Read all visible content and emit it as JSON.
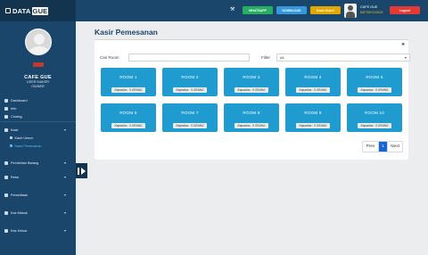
{
  "brand": {
    "name": "DATA",
    "name_badge": "GUE"
  },
  "profile": {
    "name": "CAFE GUE",
    "role_line1": "USER MAKER",
    "role_line2": "OWNER"
  },
  "sidebar": {
    "items": [
      {
        "label": "Dashboard"
      },
      {
        "label": "Info"
      },
      {
        "label": "Closing"
      },
      {
        "label": "Kasir",
        "chevron": "▾"
      },
      {
        "label": "Kasir Umum"
      },
      {
        "label": "Kasir Pemesanan"
      },
      {
        "label": "Pembelian Barang",
        "chevron": "▾"
      },
      {
        "label": "Retur",
        "chevron": "▾"
      },
      {
        "label": "Persediaan",
        "chevron": "▾"
      },
      {
        "label": "Kas Masuk",
        "chevron": "▾"
      },
      {
        "label": "Kas Keluar",
        "chevron": "▾"
      }
    ]
  },
  "topbar": {
    "whatsapp_label": "WHATSAPP",
    "download_label": "DOWNLOAD",
    "kasir_label": "Kasir Dulu!!",
    "logout_label": "Logout",
    "user_name": "CAFE GUE",
    "user_sub": "DAFTAR 01/01/21"
  },
  "page": {
    "title": "Kasir Pemesanan"
  },
  "filters": {
    "search_label": "Cari Room",
    "search_value": "",
    "filter_label": "Filter",
    "filter_value": "All",
    "filter_chevron": "▾"
  },
  "rooms": [
    {
      "name": "ROOM 1",
      "capacity": "Kapasitas : 5 ORANG"
    },
    {
      "name": "ROOM 2",
      "capacity": "Kapasitas : 5 ORANG"
    },
    {
      "name": "ROOM 3",
      "capacity": "Kapasitas : 5 ORANG"
    },
    {
      "name": "ROOM 4",
      "capacity": "Kapasitas : 5 ORANG"
    },
    {
      "name": "ROOM 5",
      "capacity": "Kapasitas : 5 ORANG"
    },
    {
      "name": "ROOM 6",
      "capacity": "Kapasitas : 5 ORANG"
    },
    {
      "name": "ROOM 7",
      "capacity": "Kapasitas : 5 ORANG"
    },
    {
      "name": "ROOM 8",
      "capacity": "Kapasitas : 5 ORANG"
    },
    {
      "name": "ROOM 9",
      "capacity": "Kapasitas : 5 ORANG"
    },
    {
      "name": "ROOM 10",
      "capacity": "Kapasitas : 5 ORANG"
    }
  ],
  "pagination": {
    "prev": "Prev",
    "current": "1",
    "next": "Next"
  },
  "colors": {
    "sidebar": "#1b466b",
    "room": "#1f9bcf",
    "active_page": "#1565d8",
    "active_menu": "#4fc3f7"
  }
}
